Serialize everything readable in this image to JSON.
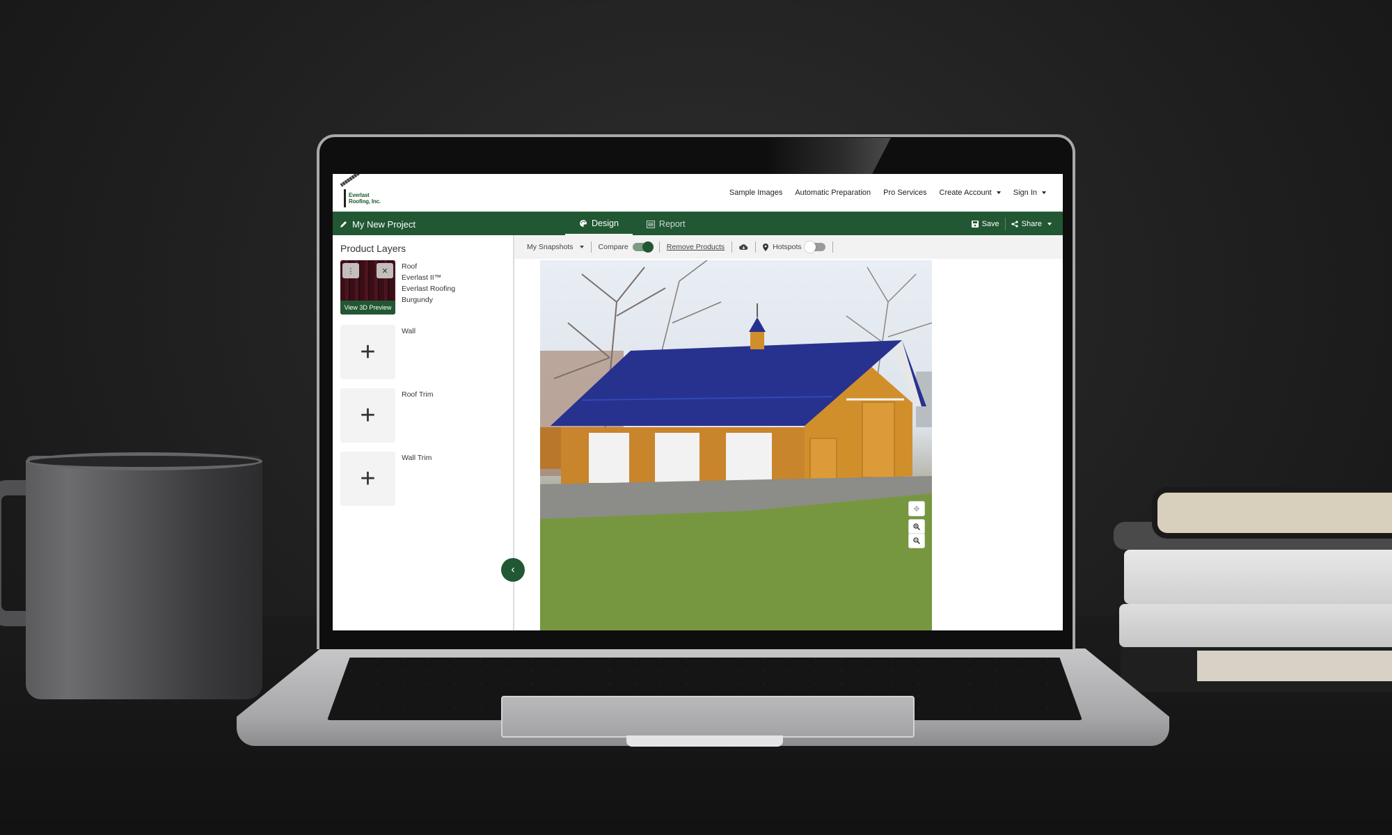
{
  "app": {
    "brand": {
      "line1": "Everlast",
      "line2": "Roofing, Inc."
    },
    "topnav": [
      {
        "label": "Sample Images",
        "has_caret": false
      },
      {
        "label": "Automatic Preparation",
        "has_caret": false
      },
      {
        "label": "Pro Services",
        "has_caret": false
      },
      {
        "label": "Create Account",
        "has_caret": true
      },
      {
        "label": "Sign In",
        "has_caret": true
      }
    ],
    "project": {
      "title": "My New Project",
      "icon": "pencil-icon"
    },
    "tabs": [
      {
        "label": "Design",
        "icon": "palette-icon",
        "active": true
      },
      {
        "label": "Report",
        "icon": "list-icon",
        "active": false
      }
    ],
    "actions": {
      "save": "Save",
      "share": "Share"
    },
    "toolbar": {
      "snapshots": "My Snapshots",
      "compare": "Compare",
      "compare_on": true,
      "remove_products": "Remove Products",
      "hotspots": "Hotspots",
      "hotspots_on": false
    },
    "left_panel": {
      "title": "Product Layers",
      "layers": [
        {
          "category": "Roof",
          "lines": [
            "Everlast II™",
            "Everlast Roofing",
            "Burgundy"
          ],
          "has_product": true,
          "preview_label": "View 3D Preview",
          "swatch_color": "#4b1520"
        },
        {
          "category": "Wall",
          "lines": [],
          "has_product": false
        },
        {
          "category": "Roof Trim",
          "lines": [],
          "has_product": false
        },
        {
          "category": "Wall Trim",
          "lines": [],
          "has_product": false
        }
      ]
    },
    "canvas": {
      "description": "Barn with blue roof and wood siding, three white garage doors",
      "roof_color": "#27328f",
      "zoom_controls": [
        "move-icon",
        "zoom-in-icon",
        "zoom-out-icon"
      ]
    },
    "colors": {
      "brand_green": "#215732",
      "toolbar_bg": "#f2f2f2"
    }
  }
}
